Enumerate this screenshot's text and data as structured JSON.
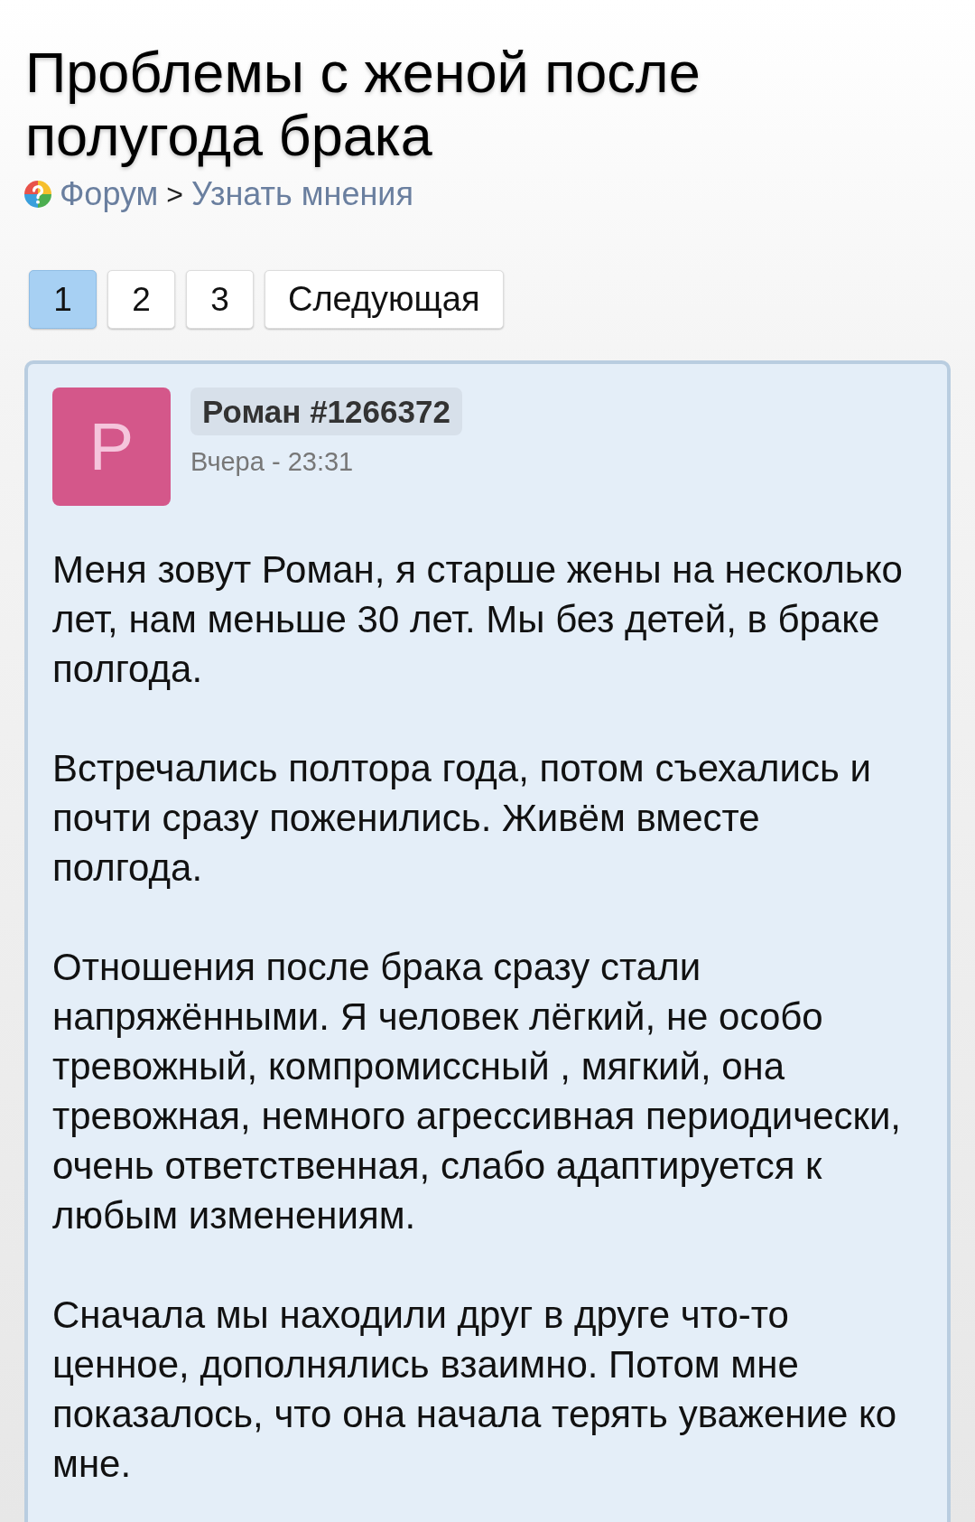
{
  "header": {
    "title": "Проблемы с женой после полугода брака",
    "breadcrumb": {
      "items": [
        {
          "label": "Форум"
        },
        {
          "label": "Узнать мнения"
        }
      ],
      "separator": ">"
    }
  },
  "pagination": {
    "pages": [
      {
        "label": "1",
        "selected": true
      },
      {
        "label": "2",
        "selected": false
      },
      {
        "label": "3",
        "selected": false
      }
    ],
    "next": "Следующая"
  },
  "post": {
    "avatar": {
      "letter": "Р"
    },
    "author": "Роман #1266372",
    "time": "Вчера - 23:31",
    "paragraphs": [
      "Меня зовут Роман, я старше жены на несколько лет, нам меньше 30 лет. Мы без детей, в браке полгода.",
      "Встречались полтора года, потом съехались и почти сразу поженились. Живём вместе полгода.",
      "Отношения после брака сразу стали напряжёнными. Я человек лёгкий, не особо тревожный, компромиссный , мягкий, она тревожная, немного агрессивная периодически, очень ответственная, слабо адаптируется к любым изменениям.",
      "Сначала мы находили друг в друге что-то ценное, дополнялись взаимно. Потом мне показалось, что она начала терять уважение ко мне."
    ]
  }
}
